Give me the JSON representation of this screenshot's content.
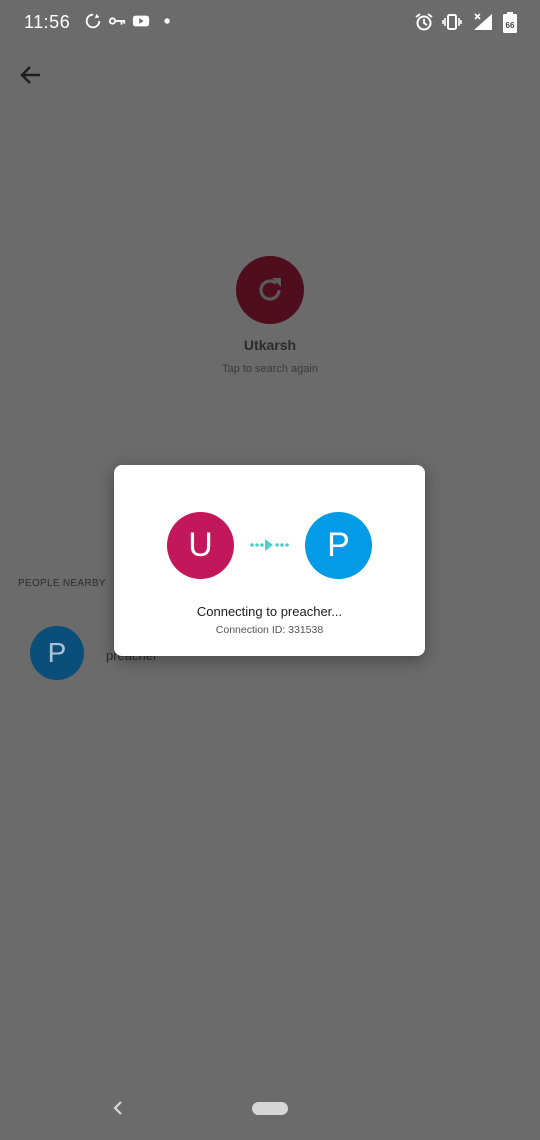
{
  "status_bar": {
    "time": "11:56",
    "battery_level": "66",
    "icons": [
      "sync-icon",
      "key-icon",
      "youtube-icon",
      "dot-icon",
      "alarm-icon",
      "vibrate-icon",
      "signal-icon",
      "battery-icon"
    ]
  },
  "profile": {
    "name": "Utkarsh",
    "hint": "Tap to search again",
    "avatar_icon": "refresh-icon"
  },
  "nearby": {
    "section_title": "PEOPLE NEARBY",
    "items": [
      {
        "initial": "P",
        "name": "preacher"
      }
    ]
  },
  "dialog": {
    "from_initial": "U",
    "to_initial": "P",
    "title": "Connecting to preacher...",
    "connection_id_text": "Connection ID: 331538",
    "colors": {
      "from": "#c2185b",
      "to": "#039be5",
      "arrow": "#4dd0c7"
    }
  },
  "colors": {
    "scrim": "#6b6b6b",
    "dialog_bg": "#ffffff"
  }
}
